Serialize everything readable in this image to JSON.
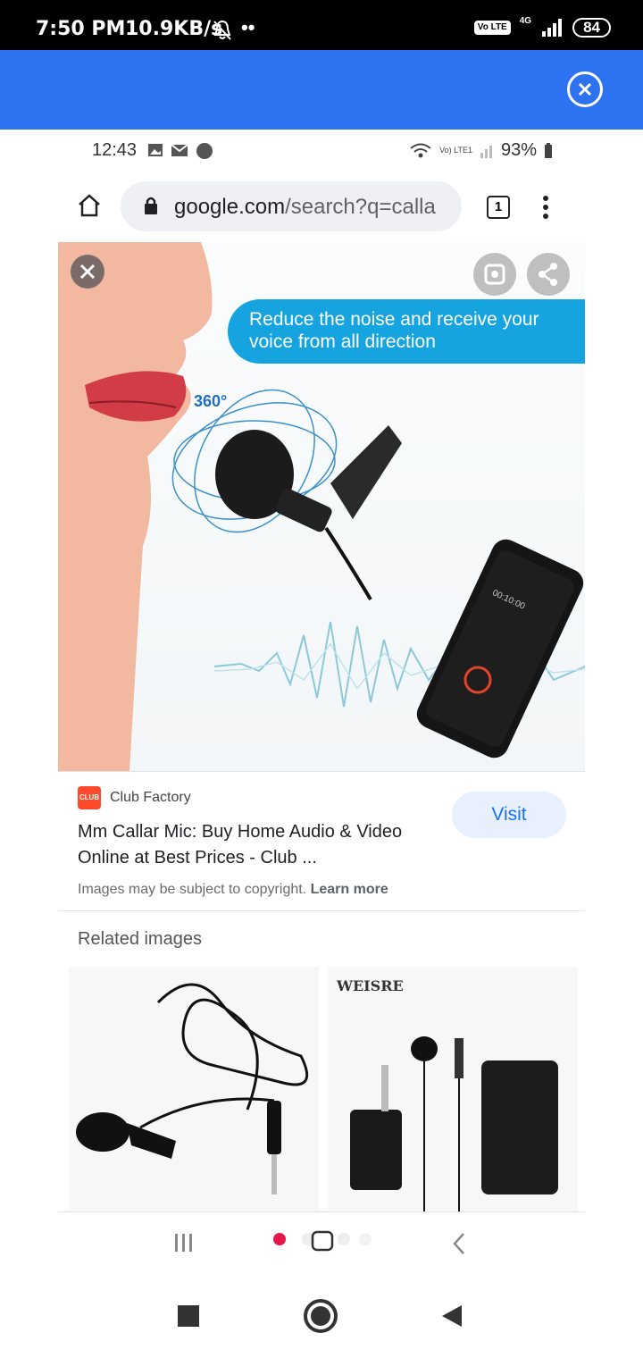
{
  "status_bar": {
    "time": "7:50 PM",
    "net_speed": "10.9KB/s",
    "network": "4G",
    "volte": "Vo LTE",
    "battery": "84"
  },
  "overlay": {
    "close_icon": "close-circle-icon",
    "bar_color": "#2d72f0"
  },
  "inner_screenshot": {
    "status": {
      "time": "12:43",
      "battery": "93%",
      "network_label": "Vo) LTE1"
    },
    "browser": {
      "url_main": "google.com",
      "url_path": "/search?q=calla",
      "tab_count": "1"
    },
    "hero": {
      "bubble_line1": "Reduce the noise and receive your",
      "bubble_line2": "voice from all direction",
      "degree_label": "360°",
      "phone_screen_time": "00:10:00"
    },
    "result": {
      "source": "Club Factory",
      "source_logo_text": "CLUB",
      "title": "Mm Callar Mic: Buy Home Audio & Video Online at Best Prices - Club ...",
      "visit_label": "Visit",
      "copyright": "Images may be subject to copyright.",
      "learn_more": "Learn more"
    },
    "related": {
      "heading": "Related images",
      "items": [
        {
          "brand": ""
        },
        {
          "brand": "WEISRE"
        }
      ]
    }
  }
}
